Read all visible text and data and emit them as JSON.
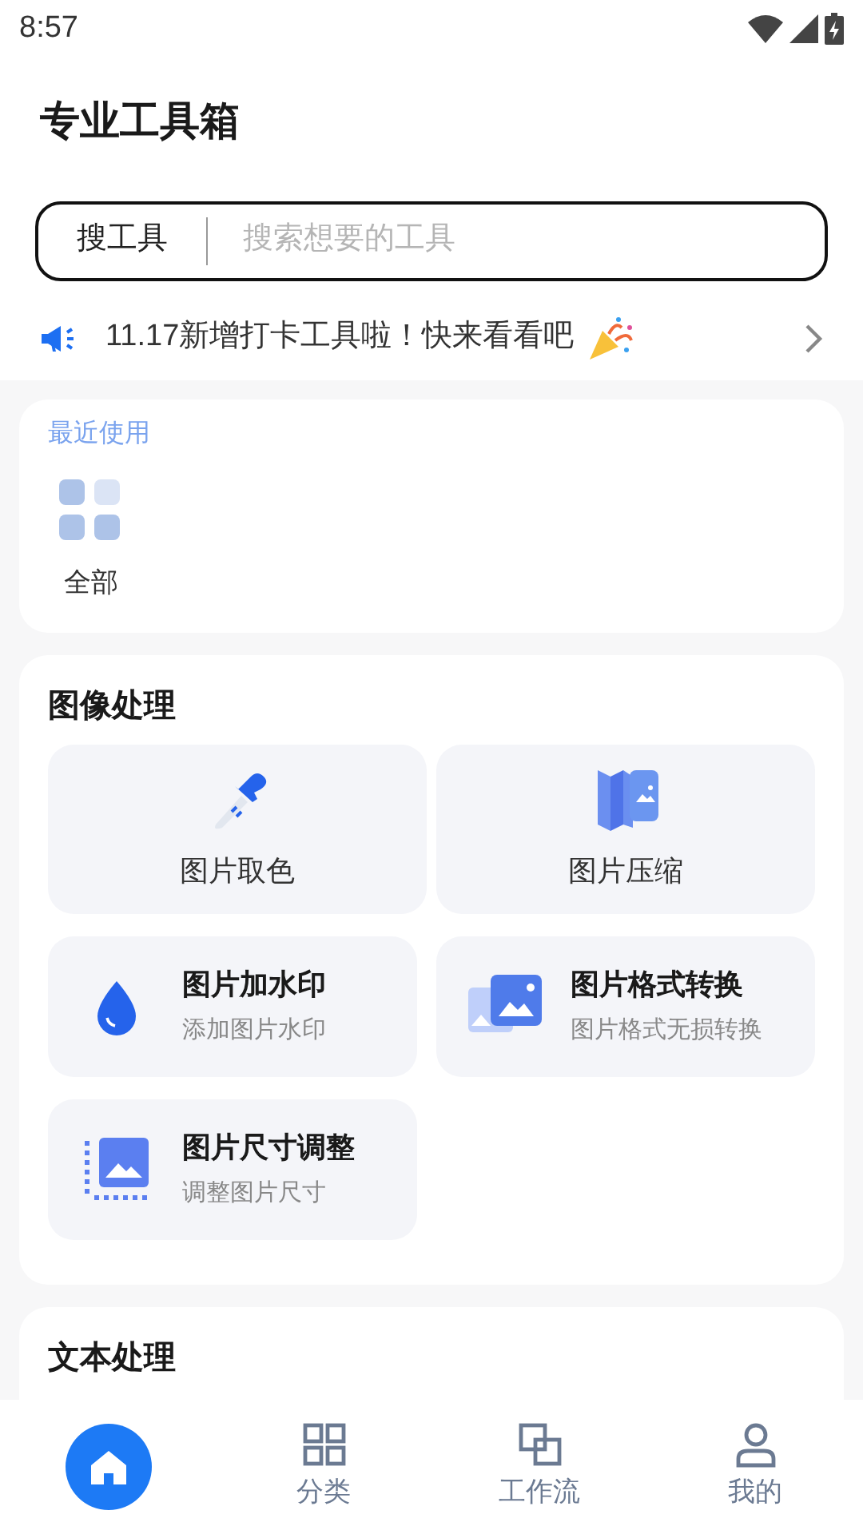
{
  "status_bar": {
    "time": "8:57"
  },
  "title": "专业工具箱",
  "search": {
    "label": "搜工具",
    "placeholder": "搜索想要的工具"
  },
  "notice": {
    "text": "11.17新增打卡工具啦！快来看看吧"
  },
  "recent": {
    "title": "最近使用",
    "items": [
      {
        "label": "全部"
      }
    ]
  },
  "sections": [
    {
      "title": "图像处理",
      "tools": [
        {
          "kind": "large",
          "title": "图片取色"
        },
        {
          "kind": "large",
          "title": "图片压缩"
        },
        {
          "kind": "wide",
          "title": "图片加水印",
          "subtitle": "添加图片水印"
        },
        {
          "kind": "wide",
          "title": "图片格式转换",
          "subtitle": "图片格式无损转换"
        },
        {
          "kind": "wide",
          "title": "图片尺寸调整",
          "subtitle": "调整图片尺寸"
        }
      ]
    },
    {
      "title": "文本处理"
    }
  ],
  "nav": [
    {
      "selected": true
    },
    {
      "label": "分类",
      "selected": false
    },
    {
      "label": "工作流",
      "selected": false
    },
    {
      "label": "我的",
      "selected": false
    }
  ]
}
